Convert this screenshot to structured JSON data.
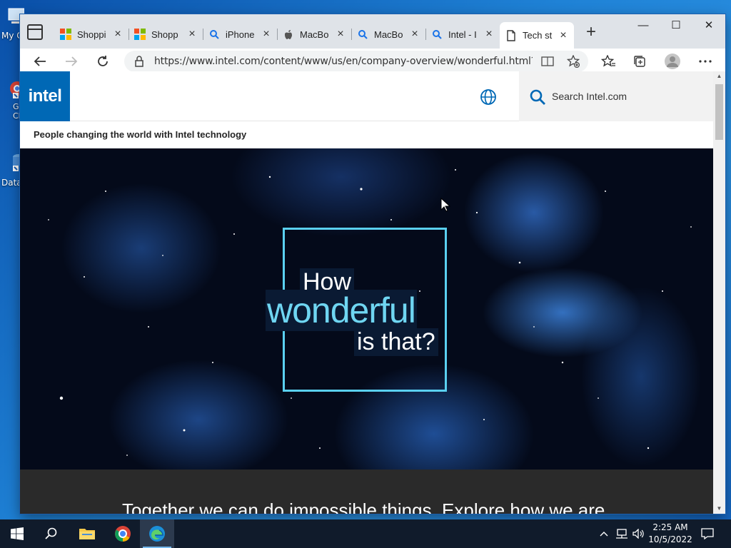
{
  "desktop": {
    "icons": [
      {
        "label": "My C",
        "icon": "computer-icon"
      },
      {
        "label": "G\nCh",
        "icon": "chrome-shortcut-icon"
      },
      {
        "label": "Data",
        "icon": "data-shortcut-icon"
      }
    ]
  },
  "browser": {
    "tabs": [
      {
        "title": "Shoppi",
        "favicon": "microsoft-icon",
        "active": false
      },
      {
        "title": "Shopp",
        "favicon": "microsoft-icon",
        "active": false
      },
      {
        "title": "iPhone",
        "favicon": "search-icon",
        "active": false
      },
      {
        "title": "MacBo",
        "favicon": "apple-icon",
        "active": false
      },
      {
        "title": "MacBo",
        "favicon": "search-icon",
        "active": false
      },
      {
        "title": "Intel - I",
        "favicon": "search-icon",
        "active": false
      },
      {
        "title": "Tech st",
        "favicon": "page-icon",
        "active": true
      }
    ],
    "new_tab_label": "+",
    "window_controls": {
      "minimize": "—",
      "maximize": "☐",
      "close": "✕"
    },
    "url": "https://www.intel.com/content/www/us/en/company-overview/wonderful.html?cid..."
  },
  "site": {
    "logo": "intel",
    "search_placeholder": "Search Intel.com",
    "tagline": "People changing the world with Intel technology",
    "hero": {
      "line1": "How",
      "line2": "wonderful",
      "line3": "is that?"
    },
    "band_text": "Together we can do impossible things. Explore how we are"
  },
  "taskbar": {
    "pinned": [
      "windows-start-icon",
      "search-icon",
      "file-explorer-icon",
      "chrome-icon",
      "edge-icon"
    ],
    "clock_time": "2:25 AM",
    "clock_date": "10/5/2022"
  },
  "colors": {
    "intel_blue": "#0068b5",
    "hero_accent": "#6fd6f2",
    "taskbar": "#101b2b"
  }
}
